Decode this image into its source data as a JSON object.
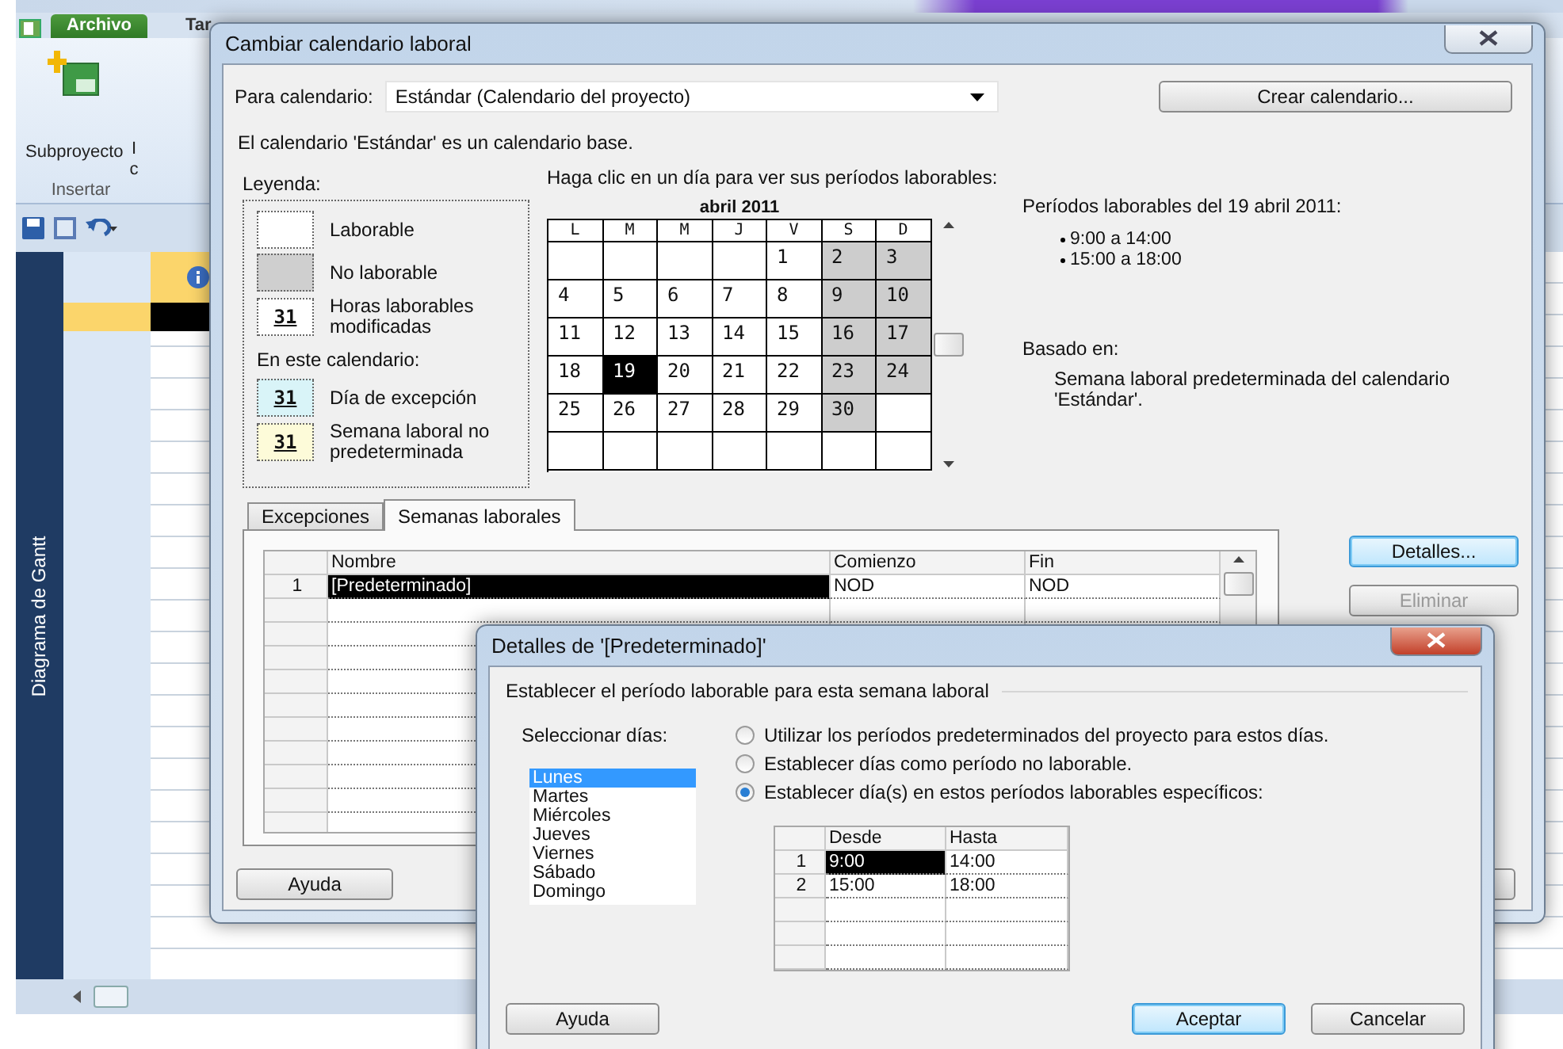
{
  "app": {
    "ribbon_tabs": [
      {
        "label": "Archivo",
        "selected": true
      },
      {
        "label": "Tar",
        "selected": false
      }
    ],
    "ribbon_commands": [
      {
        "lines": [
          "Subproyecto"
        ]
      },
      {
        "lines": [
          "I",
          "c"
        ]
      }
    ],
    "ribbon_group": "Insertar",
    "view_bar": "Diagrama de Gantt"
  },
  "calendar_dialog": {
    "title": "Cambiar calendario laboral",
    "calendar_label": "Para calendario:",
    "calendar_value": "Estándar (Calendario del proyecto)",
    "create_button": "Crear calendario...",
    "base_note": "El calendario 'Estándar' es un calendario base.",
    "legend_title": "Leyenda:",
    "legend": [
      {
        "kind": "working",
        "label": "Laborable"
      },
      {
        "kind": "nonworking",
        "label": "No laborable"
      },
      {
        "kind": "modified",
        "swatch": "31",
        "label": "Horas laborables modificadas"
      },
      {
        "kind": "heading",
        "label": "En este calendario:"
      },
      {
        "kind": "exception",
        "swatch": "31",
        "label": "Día de excepción"
      },
      {
        "kind": "nondefault",
        "swatch": "31",
        "label": "Semana laboral no predeterminada"
      }
    ],
    "calendar_hint": "Haga clic en un día para ver sus períodos laborables:",
    "calendar": {
      "month": "abril 2011",
      "weekdays": [
        "L",
        "M",
        "M",
        "J",
        "V",
        "S",
        "D"
      ],
      "weeks": [
        [
          {
            "kind": "blank"
          },
          {
            "kind": "blank"
          },
          {
            "kind": "blank"
          },
          {
            "kind": "blank"
          },
          {
            "kind": "day",
            "day": "1",
            "nonworking": false,
            "selected": false
          },
          {
            "kind": "day",
            "day": "2",
            "nonworking": true,
            "selected": false
          },
          {
            "kind": "day",
            "day": "3",
            "nonworking": true,
            "selected": false
          }
        ],
        [
          {
            "kind": "day",
            "day": "4",
            "nonworking": false,
            "selected": false
          },
          {
            "kind": "day",
            "day": "5",
            "nonworking": false,
            "selected": false
          },
          {
            "kind": "day",
            "day": "6",
            "nonworking": false,
            "selected": false
          },
          {
            "kind": "day",
            "day": "7",
            "nonworking": false,
            "selected": false
          },
          {
            "kind": "day",
            "day": "8",
            "nonworking": false,
            "selected": false
          },
          {
            "kind": "day",
            "day": "9",
            "nonworking": true,
            "selected": false
          },
          {
            "kind": "day",
            "day": "10",
            "nonworking": true,
            "selected": false
          }
        ],
        [
          {
            "kind": "day",
            "day": "11",
            "nonworking": false,
            "selected": false
          },
          {
            "kind": "day",
            "day": "12",
            "nonworking": false,
            "selected": false
          },
          {
            "kind": "day",
            "day": "13",
            "nonworking": false,
            "selected": false
          },
          {
            "kind": "day",
            "day": "14",
            "nonworking": false,
            "selected": false
          },
          {
            "kind": "day",
            "day": "15",
            "nonworking": false,
            "selected": false
          },
          {
            "kind": "day",
            "day": "16",
            "nonworking": true,
            "selected": false
          },
          {
            "kind": "day",
            "day": "17",
            "nonworking": true,
            "selected": false
          }
        ],
        [
          {
            "kind": "day",
            "day": "18",
            "nonworking": false,
            "selected": false
          },
          {
            "kind": "day",
            "day": "19",
            "nonworking": false,
            "selected": true
          },
          {
            "kind": "day",
            "day": "20",
            "nonworking": false,
            "selected": false
          },
          {
            "kind": "day",
            "day": "21",
            "nonworking": false,
            "selected": false
          },
          {
            "kind": "day",
            "day": "22",
            "nonworking": false,
            "selected": false
          },
          {
            "kind": "day",
            "day": "23",
            "nonworking": true,
            "selected": false
          },
          {
            "kind": "day",
            "day": "24",
            "nonworking": true,
            "selected": false
          }
        ],
        [
          {
            "kind": "day",
            "day": "25",
            "nonworking": false,
            "selected": false
          },
          {
            "kind": "day",
            "day": "26",
            "nonworking": false,
            "selected": false
          },
          {
            "kind": "day",
            "day": "27",
            "nonworking": false,
            "selected": false
          },
          {
            "kind": "day",
            "day": "28",
            "nonworking": false,
            "selected": false
          },
          {
            "kind": "day",
            "day": "29",
            "nonworking": false,
            "selected": false
          },
          {
            "kind": "day",
            "day": "30",
            "nonworking": true,
            "selected": false
          },
          {
            "kind": "blank"
          }
        ],
        [
          {
            "kind": "blank"
          },
          {
            "kind": "blank"
          },
          {
            "kind": "blank"
          },
          {
            "kind": "blank"
          },
          {
            "kind": "blank"
          },
          {
            "kind": "blank"
          },
          {
            "kind": "blank"
          }
        ]
      ]
    },
    "periods_title": "Períodos laborables del 19 abril 2011:",
    "periods": [
      "9:00 a 14:00",
      "15:00 a 18:00"
    ],
    "based_on_title": "Basado en:",
    "based_on": "Semana laboral predeterminada del calendario 'Estándar'.",
    "tabs": [
      {
        "label": "Excepciones",
        "selected": false
      },
      {
        "label": "Semanas laborales",
        "selected": true
      }
    ],
    "table": {
      "columns": [
        "Nombre",
        "Comienzo",
        "Fin"
      ],
      "rows": [
        {
          "number": "1",
          "cells": [
            {
              "text": "[Predeterminado]",
              "selected": true
            },
            {
              "text": "NOD",
              "selected": false
            },
            {
              "text": "NOD",
              "selected": false
            }
          ]
        }
      ]
    },
    "side_buttons": [
      {
        "label": "Detalles...",
        "default": true,
        "disabled": false
      },
      {
        "label": "Eliminar",
        "default": false,
        "disabled": true
      }
    ],
    "help_button": "Ayuda"
  },
  "details_dialog": {
    "title": "Detalles de '[Predeterminado]'",
    "group_title": "Establecer el período laborable para esta semana laboral",
    "days_label": "Seleccionar días:",
    "days": [
      {
        "label": "Lunes",
        "selected": true
      },
      {
        "label": "Martes",
        "selected": false
      },
      {
        "label": "Miércoles",
        "selected": false
      },
      {
        "label": "Jueves",
        "selected": false
      },
      {
        "label": "Viernes",
        "selected": false
      },
      {
        "label": "Sábado",
        "selected": false
      },
      {
        "label": "Domingo",
        "selected": false
      }
    ],
    "options": [
      {
        "label": "Utilizar los períodos predeterminados del proyecto para estos días.",
        "selected": false
      },
      {
        "label": "Establecer días como período no laborable.",
        "selected": false
      },
      {
        "label": "Establecer día(s) en estos períodos laborables específicos:",
        "selected": true
      }
    ],
    "times": {
      "columns": [
        "Desde",
        "Hasta"
      ],
      "rows": [
        {
          "number": "1",
          "cells": [
            {
              "text": "9:00",
              "selected": true
            },
            {
              "text": "14:00",
              "selected": false
            }
          ]
        },
        {
          "number": "2",
          "cells": [
            {
              "text": "15:00",
              "selected": false
            },
            {
              "text": "18:00",
              "selected": false
            }
          ]
        }
      ]
    },
    "help_button": "Ayuda",
    "buttons": [
      {
        "label": "Aceptar",
        "default": true
      },
      {
        "label": "Cancelar",
        "default": false
      }
    ]
  }
}
